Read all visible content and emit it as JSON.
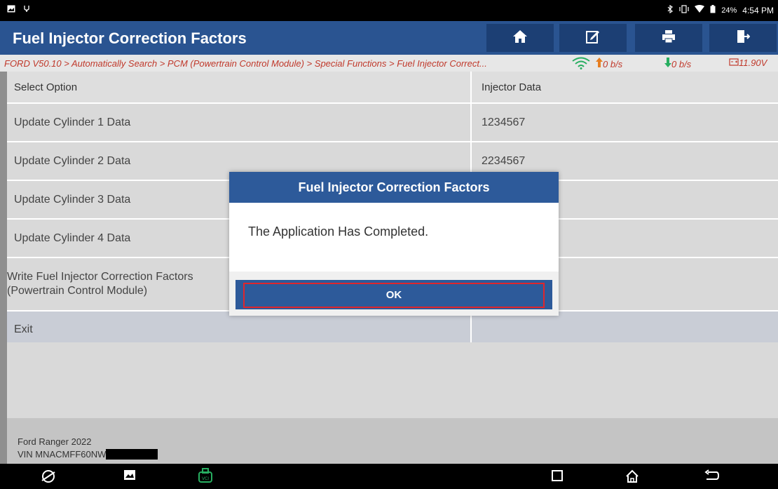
{
  "status_bar": {
    "battery": "24%",
    "time": "4:54 PM",
    "left_icons": [
      "screenshot-icon",
      "usb-debug-icon"
    ],
    "right_icons": [
      "bluetooth-icon",
      "vibrate-icon",
      "wifi-icon",
      "battery-icon"
    ]
  },
  "header": {
    "title": "Fuel Injector Correction Factors",
    "toolbar": [
      {
        "name": "home-icon"
      },
      {
        "name": "edit-icon"
      },
      {
        "name": "print-icon"
      },
      {
        "name": "exit-icon"
      }
    ]
  },
  "breadcrumb": {
    "path": "FORD V50.10 > Automatically Search > PCM (Powertrain Control Module) > Special Functions > Fuel Injector Correct...",
    "upload_rate": "0 b/s",
    "download_rate": "0 b/s",
    "voltage": "11.90V"
  },
  "table": {
    "columns": [
      "Select Option",
      "Injector Data"
    ],
    "rows": [
      {
        "option": "Update Cylinder 1 Data",
        "data": "1234567"
      },
      {
        "option": "Update Cylinder 2 Data",
        "data": "2234567"
      },
      {
        "option": "Update Cylinder 3 Data",
        "data": ""
      },
      {
        "option": "Update Cylinder 4 Data",
        "data": ""
      },
      {
        "option": "Write Fuel Injector Correction Factors (Powertrain Control Module)",
        "data": ""
      },
      {
        "option": "Exit",
        "data": ""
      }
    ]
  },
  "footer": {
    "vehicle": "Ford Ranger 2022",
    "vin": "VIN MNACMFF60NW"
  },
  "dialog": {
    "title": "Fuel Injector Correction Factors",
    "message": "The Application Has Completed.",
    "ok_label": "OK"
  },
  "colors": {
    "header_bg": "#2a5491",
    "dialog_title_bg": "#2d5a9a",
    "breadcrumb_text": "#c0392b",
    "highlight_border": "#e0262c"
  }
}
